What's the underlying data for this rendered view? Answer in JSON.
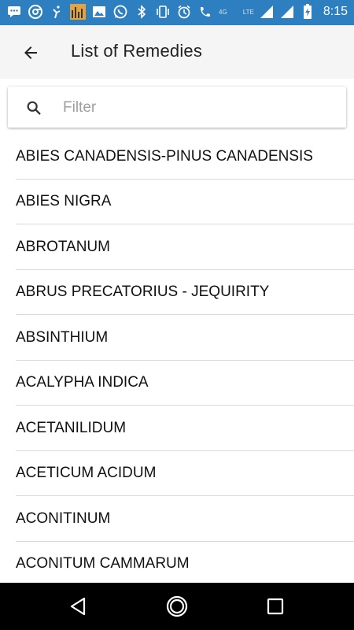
{
  "status_bar": {
    "time": "8:15",
    "network_label": "4G",
    "lte_label": "LTE",
    "icons": [
      "message-icon",
      "chrome-icon",
      "yogi-icon",
      "equalizer-app-icon",
      "gallery-icon",
      "whatsapp-icon",
      "bluetooth-icon",
      "vibrate-icon",
      "alarm-icon",
      "wifi-calling-icon",
      "signal-icon",
      "signal-icon-2",
      "battery-charging-icon"
    ]
  },
  "app_bar": {
    "title": "List of Remedies",
    "back_icon": "back-arrow-icon"
  },
  "search": {
    "placeholder": "Filter",
    "value": ""
  },
  "remedies": [
    "ABIES CANADENSIS-PINUS CANADENSIS",
    "ABIES NIGRA",
    "ABROTANUM",
    "ABRUS PRECATORIUS - JEQUIRITY",
    "ABSINTHIUM",
    "ACALYPHA INDICA",
    "ACETANILIDUM",
    "ACETICUM ACIDUM",
    "ACONITINUM",
    "ACONITUM CAMMARUM"
  ],
  "nav_bar": {
    "icons": [
      "back-triangle-icon",
      "home-circle-icon",
      "recents-square-icon"
    ]
  },
  "colors": {
    "status_bar": "#2d7fc0",
    "app_bar": "#f5f5f5",
    "divider": "#d9d9d9",
    "nav_bar": "#000000"
  }
}
